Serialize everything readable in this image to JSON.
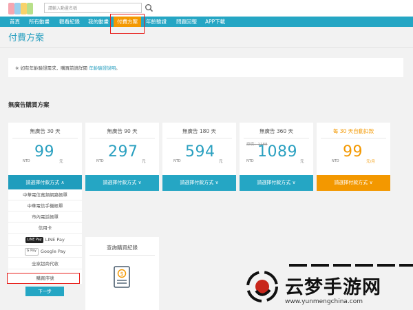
{
  "header": {
    "logo_icon": "site-logo-icon",
    "logo_colors": [
      "#f6a6b0",
      "#9ad0ee",
      "#f8d26a",
      "#b8e08a"
    ],
    "search_placeholder": "請輸入動畫名稱",
    "search_icon": "search-icon"
  },
  "nav": {
    "items": [
      {
        "label": "首頁"
      },
      {
        "label": "所有動畫"
      },
      {
        "label": "觀看紀錄"
      },
      {
        "label": "我的動畫"
      },
      {
        "label": "付費方案",
        "active": true
      },
      {
        "label": "年齡驗證"
      },
      {
        "label": "問題回報"
      },
      {
        "label": "APP下載"
      }
    ]
  },
  "page_title": "付費方案",
  "notice": {
    "text": "※ 如有年齡驗證需求，購買前請詳閱",
    "link": "年齡驗證說明",
    "suffix": "。"
  },
  "section_title": "無廣告購買方案",
  "plans": [
    {
      "name": "無廣告 30 天",
      "currency": "NTD",
      "price": "99",
      "unit": "元",
      "button": "請選擇付款方式 ∧"
    },
    {
      "name": "無廣告 90 天",
      "currency": "NTD",
      "price": "297",
      "unit": "元",
      "button": "請選擇付款方式 ∨"
    },
    {
      "name": "無廣告 180 天",
      "currency": "NTD",
      "price": "594",
      "unit": "元",
      "button": "請選擇付款方式 ∨"
    },
    {
      "name": "無廣告 360 天",
      "currency": "NTD",
      "original": "原價：1188",
      "price": "1089",
      "unit": "元",
      "button": "請選擇付款方式 ∨"
    },
    {
      "name": "每 30 天自動扣款",
      "currency": "NTD",
      "price": "99",
      "unit": "元/月",
      "button": "請選擇付款方式 ∨"
    }
  ],
  "payment_options": [
    {
      "label": "中華電信寬頻網路帳單"
    },
    {
      "label": "中華電信手機帳單"
    },
    {
      "label": "市內電話帳單"
    },
    {
      "label": "信用卡"
    },
    {
      "label": "LINE Pay",
      "badge": "LINE Pay"
    },
    {
      "label": "Google Pay",
      "badge": "G Pay"
    },
    {
      "label": "全家超商代收"
    },
    {
      "label": "購買序號"
    }
  ],
  "next_button": "下一步",
  "history": {
    "title": "查詢購買紀錄",
    "icon": "receipt-dollar-icon"
  },
  "watermark": {
    "text": "云梦手游网",
    "url": "www.yunmengchina.com"
  },
  "colors": {
    "nav": "#25a6c4",
    "active": "#f39800",
    "price": "#2aa0c0",
    "highlight": "#e8201c"
  }
}
